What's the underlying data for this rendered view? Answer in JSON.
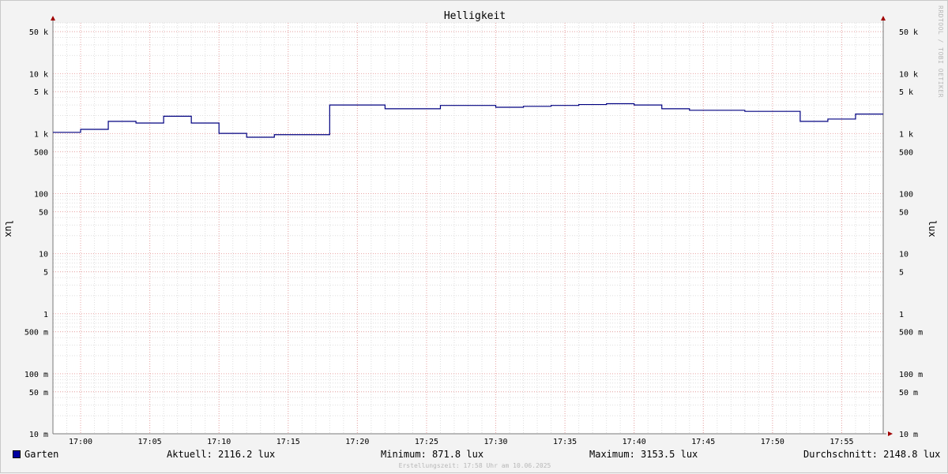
{
  "chart_data": {
    "type": "line",
    "title": "Helligkeit",
    "ylabel": "lux",
    "y_scale": "log",
    "ylim": [
      0.01,
      70000
    ],
    "x_domain": [
      "16:58",
      "17:58"
    ],
    "y_ticks": [
      {
        "value": 50000,
        "label": "50 k"
      },
      {
        "value": 10000,
        "label": "10 k"
      },
      {
        "value": 5000,
        "label": "5 k"
      },
      {
        "value": 1000,
        "label": "1 k"
      },
      {
        "value": 500,
        "label": "500"
      },
      {
        "value": 100,
        "label": "100"
      },
      {
        "value": 50,
        "label": "50"
      },
      {
        "value": 10,
        "label": "10"
      },
      {
        "value": 5,
        "label": "5"
      },
      {
        "value": 1,
        "label": "1"
      },
      {
        "value": 0.5,
        "label": "500 m"
      },
      {
        "value": 0.1,
        "label": "100 m"
      },
      {
        "value": 0.05,
        "label": "50 m"
      },
      {
        "value": 0.01,
        "label": "10 m"
      }
    ],
    "x_ticks": [
      "17:00",
      "17:05",
      "17:10",
      "17:15",
      "17:20",
      "17:25",
      "17:30",
      "17:35",
      "17:40",
      "17:45",
      "17:50",
      "17:55"
    ],
    "grid": true,
    "series": [
      {
        "name": "Garten",
        "color": "#000080",
        "step": true,
        "points": [
          {
            "x": "16:58",
            "y": 1050
          },
          {
            "x": "17:00",
            "y": 1180
          },
          {
            "x": "17:02",
            "y": 1600
          },
          {
            "x": "17:04",
            "y": 1500
          },
          {
            "x": "17:06",
            "y": 1950
          },
          {
            "x": "17:08",
            "y": 1500
          },
          {
            "x": "17:10",
            "y": 1010
          },
          {
            "x": "17:12",
            "y": 872
          },
          {
            "x": "17:14",
            "y": 960
          },
          {
            "x": "17:18",
            "y": 3000
          },
          {
            "x": "17:22",
            "y": 2600
          },
          {
            "x": "17:26",
            "y": 2950
          },
          {
            "x": "17:30",
            "y": 2750
          },
          {
            "x": "17:32",
            "y": 2850
          },
          {
            "x": "17:34",
            "y": 2950
          },
          {
            "x": "17:36",
            "y": 3050
          },
          {
            "x": "17:38",
            "y": 3150
          },
          {
            "x": "17:40",
            "y": 3000
          },
          {
            "x": "17:42",
            "y": 2600
          },
          {
            "x": "17:44",
            "y": 2450
          },
          {
            "x": "17:48",
            "y": 2350
          },
          {
            "x": "17:52",
            "y": 1600
          },
          {
            "x": "17:54",
            "y": 1750
          },
          {
            "x": "17:56",
            "y": 2116
          },
          {
            "x": "17:58",
            "y": 2116
          }
        ]
      }
    ]
  },
  "legend": {
    "series_name": "Garten",
    "current": "Aktuell: 2116.2 lux",
    "minimum": "Minimum: 871.8 lux",
    "maximum": "Maximum: 3153.5 lux",
    "average": "Durchschnitt: 2148.8 lux"
  },
  "footer": "Erstellungszeit: 17:58 Uhr am 10.06.2025",
  "watermark": "RRDTOOL / TOBI OETIKER"
}
